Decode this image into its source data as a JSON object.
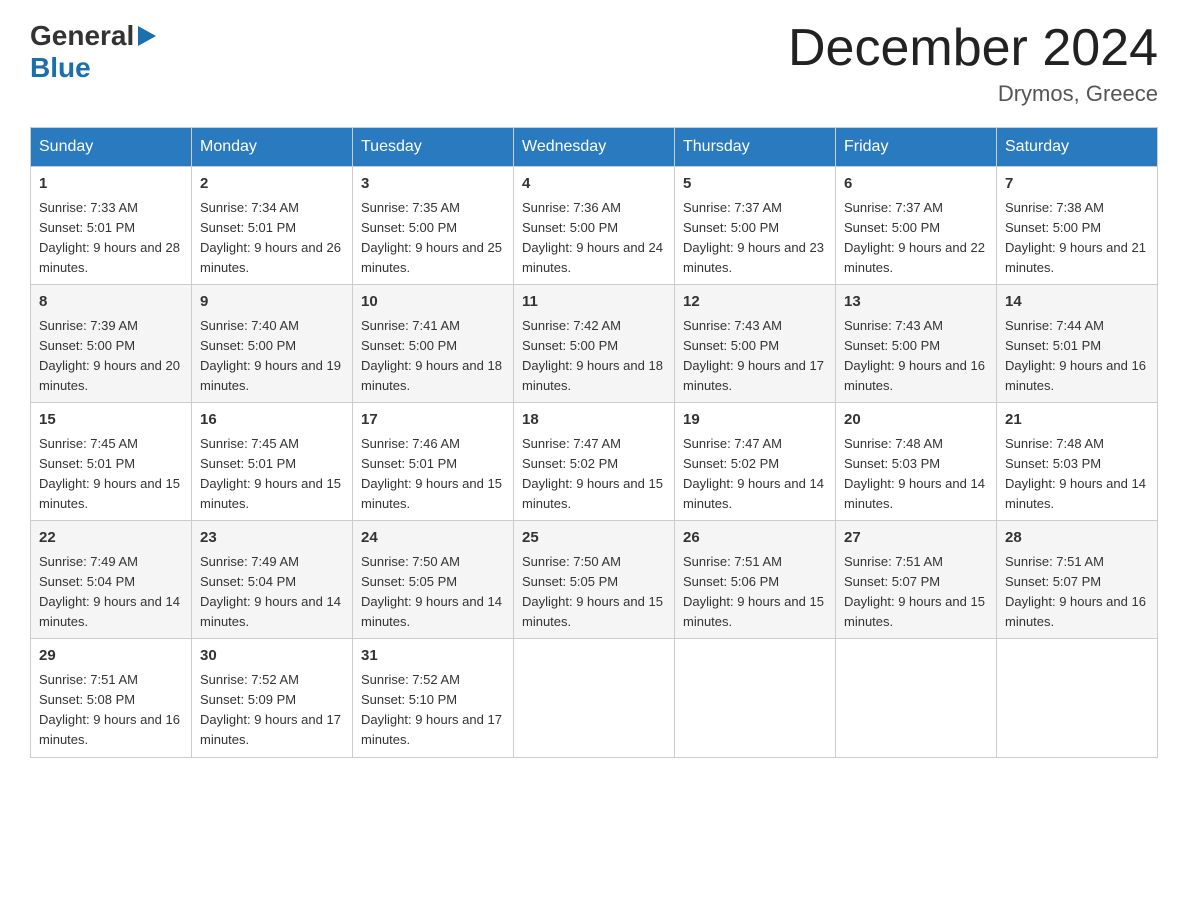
{
  "header": {
    "logo_general": "General",
    "logo_blue": "Blue",
    "month_title": "December 2024",
    "location": "Drymos, Greece"
  },
  "days_of_week": [
    "Sunday",
    "Monday",
    "Tuesday",
    "Wednesday",
    "Thursday",
    "Friday",
    "Saturday"
  ],
  "weeks": [
    [
      {
        "day": "1",
        "sunrise": "7:33 AM",
        "sunset": "5:01 PM",
        "daylight": "9 hours and 28 minutes."
      },
      {
        "day": "2",
        "sunrise": "7:34 AM",
        "sunset": "5:01 PM",
        "daylight": "9 hours and 26 minutes."
      },
      {
        "day": "3",
        "sunrise": "7:35 AM",
        "sunset": "5:00 PM",
        "daylight": "9 hours and 25 minutes."
      },
      {
        "day": "4",
        "sunrise": "7:36 AM",
        "sunset": "5:00 PM",
        "daylight": "9 hours and 24 minutes."
      },
      {
        "day": "5",
        "sunrise": "7:37 AM",
        "sunset": "5:00 PM",
        "daylight": "9 hours and 23 minutes."
      },
      {
        "day": "6",
        "sunrise": "7:37 AM",
        "sunset": "5:00 PM",
        "daylight": "9 hours and 22 minutes."
      },
      {
        "day": "7",
        "sunrise": "7:38 AM",
        "sunset": "5:00 PM",
        "daylight": "9 hours and 21 minutes."
      }
    ],
    [
      {
        "day": "8",
        "sunrise": "7:39 AM",
        "sunset": "5:00 PM",
        "daylight": "9 hours and 20 minutes."
      },
      {
        "day": "9",
        "sunrise": "7:40 AM",
        "sunset": "5:00 PM",
        "daylight": "9 hours and 19 minutes."
      },
      {
        "day": "10",
        "sunrise": "7:41 AM",
        "sunset": "5:00 PM",
        "daylight": "9 hours and 18 minutes."
      },
      {
        "day": "11",
        "sunrise": "7:42 AM",
        "sunset": "5:00 PM",
        "daylight": "9 hours and 18 minutes."
      },
      {
        "day": "12",
        "sunrise": "7:43 AM",
        "sunset": "5:00 PM",
        "daylight": "9 hours and 17 minutes."
      },
      {
        "day": "13",
        "sunrise": "7:43 AM",
        "sunset": "5:00 PM",
        "daylight": "9 hours and 16 minutes."
      },
      {
        "day": "14",
        "sunrise": "7:44 AM",
        "sunset": "5:01 PM",
        "daylight": "9 hours and 16 minutes."
      }
    ],
    [
      {
        "day": "15",
        "sunrise": "7:45 AM",
        "sunset": "5:01 PM",
        "daylight": "9 hours and 15 minutes."
      },
      {
        "day": "16",
        "sunrise": "7:45 AM",
        "sunset": "5:01 PM",
        "daylight": "9 hours and 15 minutes."
      },
      {
        "day": "17",
        "sunrise": "7:46 AM",
        "sunset": "5:01 PM",
        "daylight": "9 hours and 15 minutes."
      },
      {
        "day": "18",
        "sunrise": "7:47 AM",
        "sunset": "5:02 PM",
        "daylight": "9 hours and 15 minutes."
      },
      {
        "day": "19",
        "sunrise": "7:47 AM",
        "sunset": "5:02 PM",
        "daylight": "9 hours and 14 minutes."
      },
      {
        "day": "20",
        "sunrise": "7:48 AM",
        "sunset": "5:03 PM",
        "daylight": "9 hours and 14 minutes."
      },
      {
        "day": "21",
        "sunrise": "7:48 AM",
        "sunset": "5:03 PM",
        "daylight": "9 hours and 14 minutes."
      }
    ],
    [
      {
        "day": "22",
        "sunrise": "7:49 AM",
        "sunset": "5:04 PM",
        "daylight": "9 hours and 14 minutes."
      },
      {
        "day": "23",
        "sunrise": "7:49 AM",
        "sunset": "5:04 PM",
        "daylight": "9 hours and 14 minutes."
      },
      {
        "day": "24",
        "sunrise": "7:50 AM",
        "sunset": "5:05 PM",
        "daylight": "9 hours and 14 minutes."
      },
      {
        "day": "25",
        "sunrise": "7:50 AM",
        "sunset": "5:05 PM",
        "daylight": "9 hours and 15 minutes."
      },
      {
        "day": "26",
        "sunrise": "7:51 AM",
        "sunset": "5:06 PM",
        "daylight": "9 hours and 15 minutes."
      },
      {
        "day": "27",
        "sunrise": "7:51 AM",
        "sunset": "5:07 PM",
        "daylight": "9 hours and 15 minutes."
      },
      {
        "day": "28",
        "sunrise": "7:51 AM",
        "sunset": "5:07 PM",
        "daylight": "9 hours and 16 minutes."
      }
    ],
    [
      {
        "day": "29",
        "sunrise": "7:51 AM",
        "sunset": "5:08 PM",
        "daylight": "9 hours and 16 minutes."
      },
      {
        "day": "30",
        "sunrise": "7:52 AM",
        "sunset": "5:09 PM",
        "daylight": "9 hours and 17 minutes."
      },
      {
        "day": "31",
        "sunrise": "7:52 AM",
        "sunset": "5:10 PM",
        "daylight": "9 hours and 17 minutes."
      },
      null,
      null,
      null,
      null
    ]
  ]
}
